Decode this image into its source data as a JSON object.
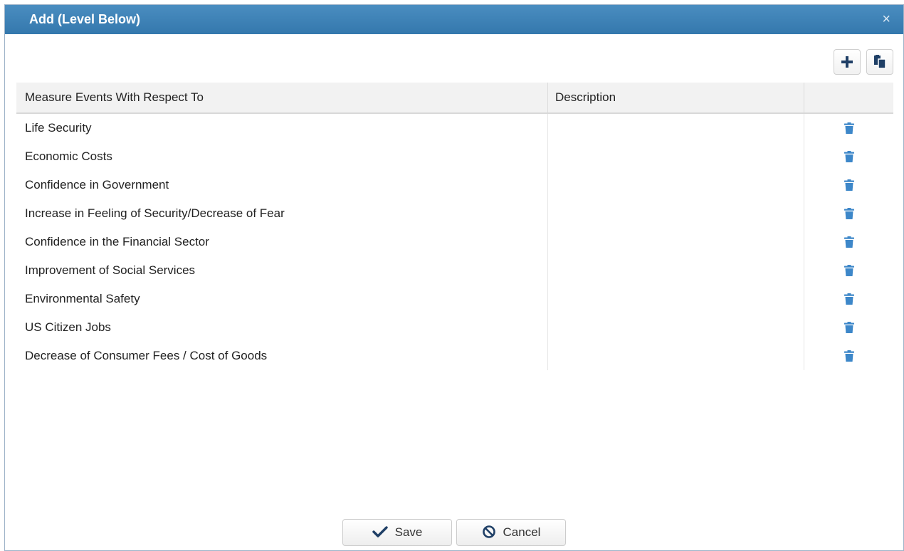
{
  "dialog": {
    "title": "Add (Level Below)",
    "close_glyph": "×"
  },
  "toolbar": {
    "add_icon": "plus-icon",
    "paste_icon": "paste-icon"
  },
  "table": {
    "headers": [
      "Measure Events With Respect To",
      "Description",
      ""
    ],
    "rows": [
      {
        "measure": "Life Security",
        "description": ""
      },
      {
        "measure": "Economic Costs",
        "description": ""
      },
      {
        "measure": "Confidence in Government",
        "description": ""
      },
      {
        "measure": "Increase in Feeling of Security/Decrease of Fear",
        "description": ""
      },
      {
        "measure": "Confidence in the Financial Sector",
        "description": ""
      },
      {
        "measure": "Improvement of Social Services",
        "description": ""
      },
      {
        "measure": "Environmental Safety",
        "description": ""
      },
      {
        "measure": "US Citizen Jobs",
        "description": ""
      },
      {
        "measure": "Decrease of Consumer Fees / Cost of Goods",
        "description": ""
      }
    ],
    "row_action_icon": "trash-icon"
  },
  "footer": {
    "save_label": "Save",
    "cancel_label": "Cancel"
  },
  "colors": {
    "titlebar": "#3a80b5",
    "accent_icon": "#3d87c9",
    "toolbar_icon": "#1f3f66"
  }
}
